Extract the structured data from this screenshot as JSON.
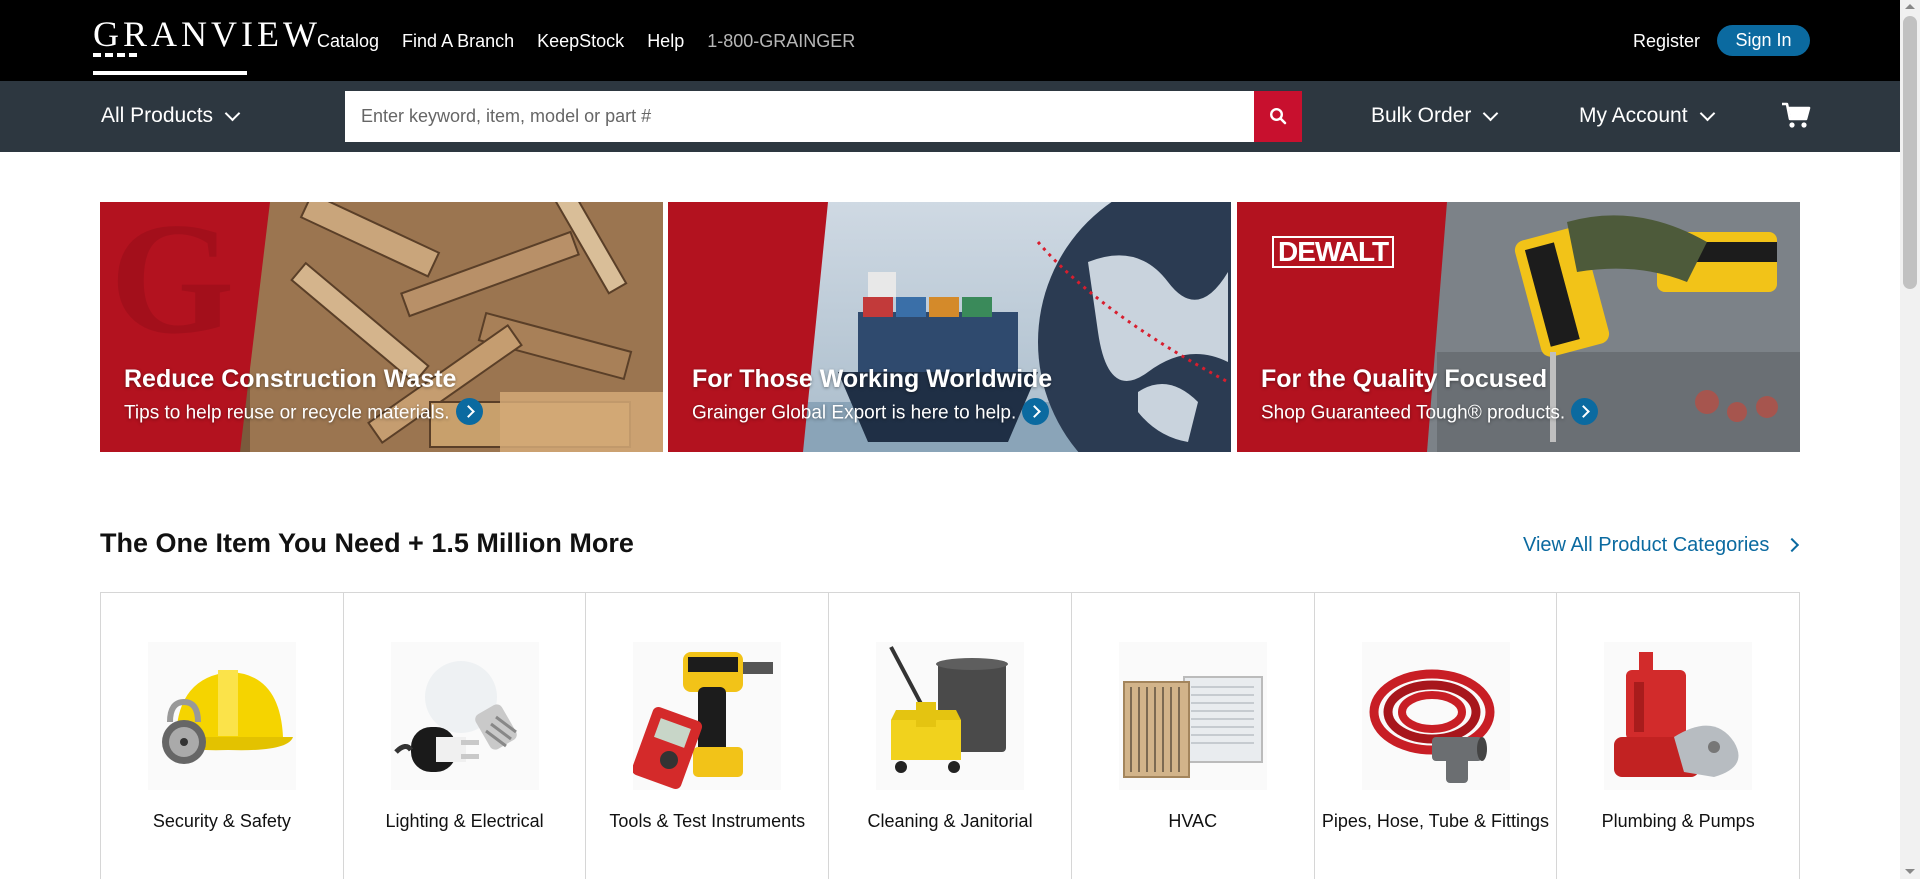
{
  "brand": {
    "name": "GRANVIEW"
  },
  "topnav": {
    "items": [
      "Catalog",
      "Find A Branch",
      "KeepStock",
      "Help"
    ],
    "phone": "1-800-GRAINGER",
    "register": "Register",
    "signin": "Sign In"
  },
  "navbar": {
    "all_products": "All Products",
    "search_placeholder": "Enter keyword, item, model or part #",
    "bulk_order": "Bulk Order",
    "my_account": "My Account"
  },
  "banners": [
    {
      "title": "Reduce Construction Waste",
      "subtitle": "Tips to help reuse or recycle materials."
    },
    {
      "title": "For Those Working Worldwide",
      "subtitle": "Grainger Global Export is here to help."
    },
    {
      "title": "For the Quality Focused",
      "subtitle": "Shop Guaranteed Tough® products.",
      "logo": "DEWALT"
    }
  ],
  "section": {
    "title": "The One Item You Need + 1.5 Million More",
    "view_all": "View All Product Categories"
  },
  "categories": [
    {
      "label": "Security & Safety",
      "icon": "hard-hat-lock-icon"
    },
    {
      "label": "Lighting & Electrical",
      "icon": "bulb-plug-icon"
    },
    {
      "label": "Tools & Test Instruments",
      "icon": "drill-multimeter-icon"
    },
    {
      "label": "Cleaning & Janitorial",
      "icon": "mop-bucket-icon"
    },
    {
      "label": "HVAC",
      "icon": "air-conditioner-icon"
    },
    {
      "label": "Pipes, Hose, Tube & Fittings",
      "icon": "hose-fitting-icon"
    },
    {
      "label": "Plumbing & Pumps",
      "icon": "sump-pump-icon"
    }
  ],
  "colors": {
    "accent_blue": "#0b6aa0",
    "brand_red": "#c8102e",
    "navbar": "#2d3740"
  }
}
